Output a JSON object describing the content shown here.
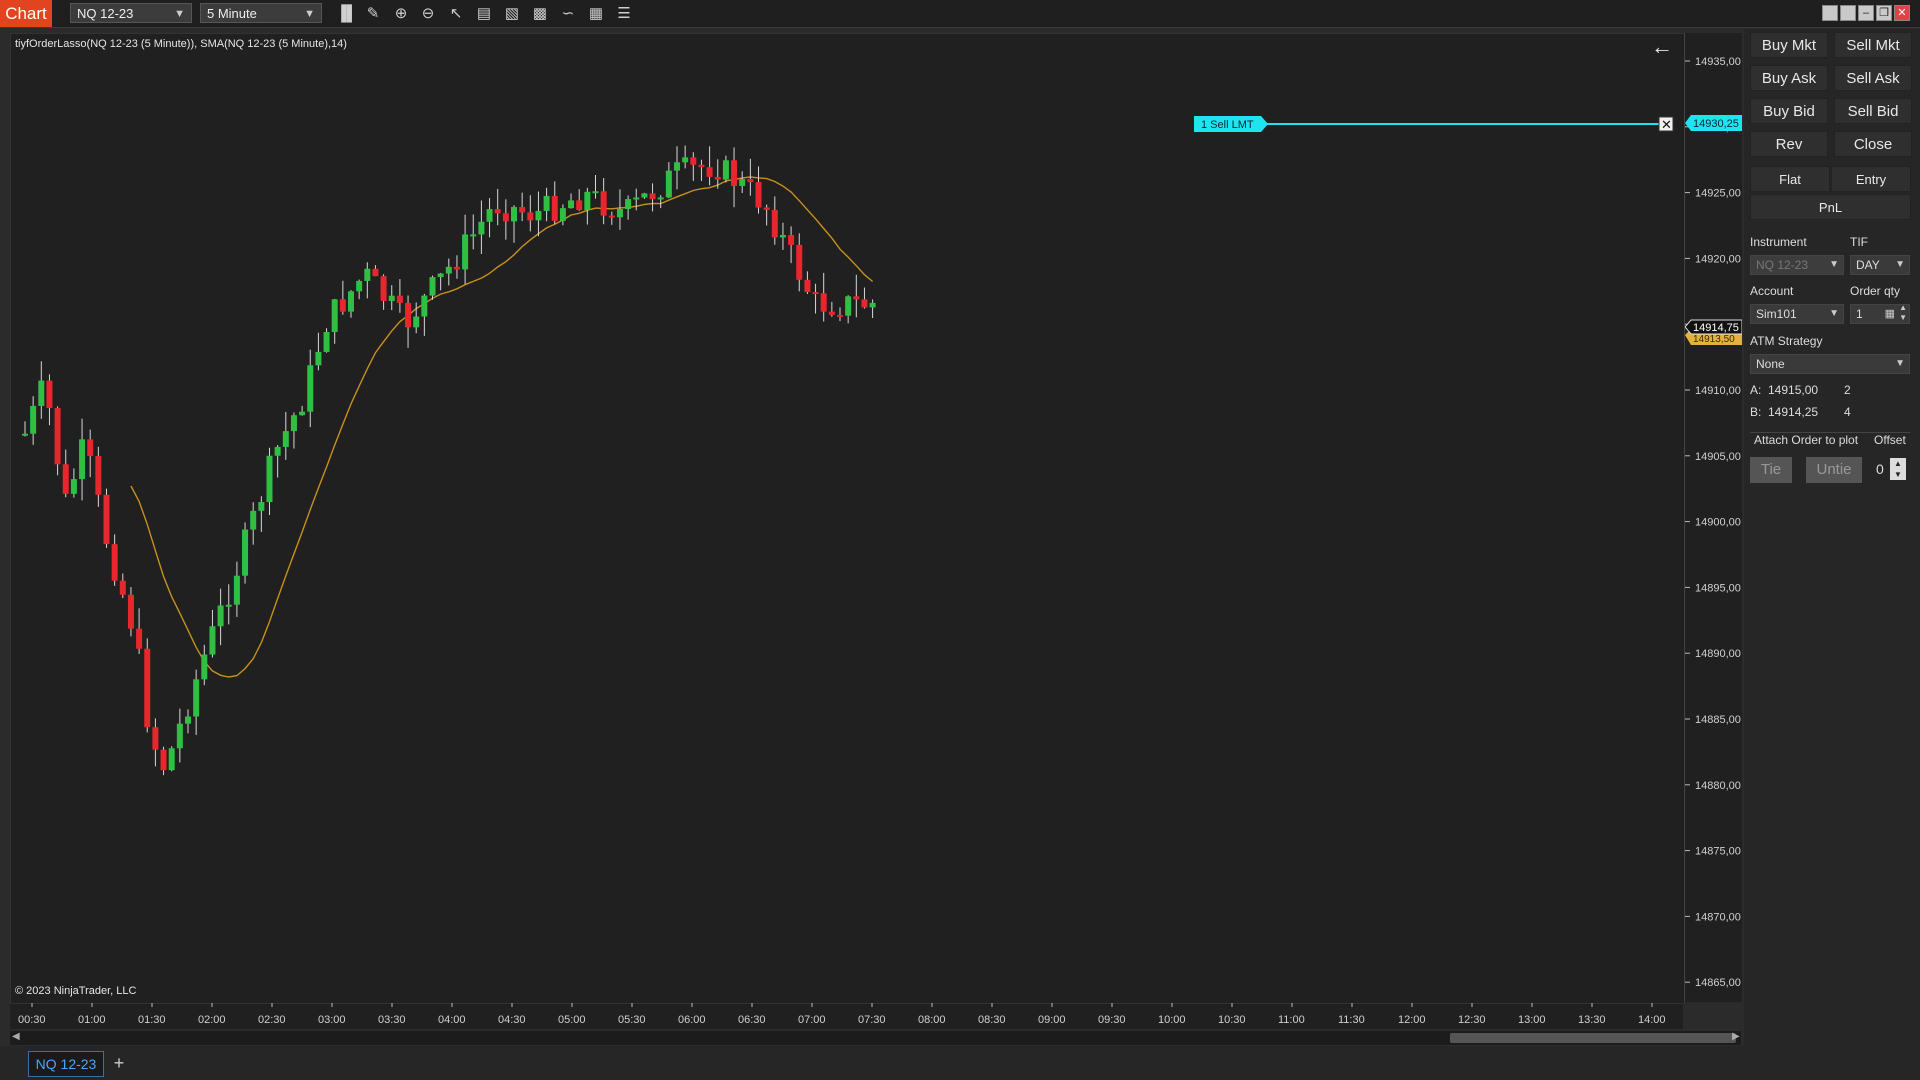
{
  "toolbar": {
    "chart_label": "Chart",
    "instrument": "NQ 12-23",
    "interval": "5 Minute",
    "tools": [
      "bar-chart-icon",
      "pencil-icon",
      "zoom-in-icon",
      "zoom-out-icon",
      "pointer-icon",
      "properties-icon",
      "data-box-icon",
      "strategies-icon",
      "indicators-icon",
      "calculator-icon",
      "list-icon"
    ]
  },
  "chart": {
    "indicator_label": "tiyfOrderLasso(NQ 12-23 (5 Minute)), SMA(NQ 12-23 (5 Minute),14)",
    "copyright": "© 2023 NinjaTrader, LLC",
    "order_label": "1  Sell LMT",
    "order_price": "14930,25",
    "last_price": "14914,75",
    "bid_marker": "14913,50",
    "price_ticks": [
      "14935,00",
      "14930,00",
      "14925,00",
      "14920,00",
      "14915,00",
      "14910,00",
      "14905,00",
      "14900,00",
      "14895,00",
      "14890,00",
      "14885,00",
      "14880,00",
      "14875,00",
      "14870,00",
      "14865,00"
    ],
    "time_ticks": [
      "00:30",
      "01:00",
      "01:30",
      "02:00",
      "02:30",
      "03:00",
      "03:30",
      "04:00",
      "04:30",
      "05:00",
      "05:30",
      "06:00",
      "06:30",
      "07:00",
      "07:30",
      "08:00",
      "08:30",
      "09:00",
      "09:30",
      "10:00",
      "10:30",
      "11:00",
      "11:30",
      "12:00",
      "12:30",
      "13:00",
      "13:30",
      "14:00"
    ],
    "colors": {
      "up": "#2fc043",
      "down": "#e8262d",
      "sma": "#c8901a",
      "order": "#1ee4f0",
      "background": "#202020"
    }
  },
  "tabs": {
    "active": "NQ 12-23",
    "add": "+"
  },
  "panel": {
    "buy_mkt": "Buy Mkt",
    "sell_mkt": "Sell Mkt",
    "buy_ask": "Buy Ask",
    "sell_ask": "Sell Ask",
    "buy_bid": "Buy Bid",
    "sell_bid": "Sell Bid",
    "rev": "Rev",
    "close": "Close",
    "flat": "Flat",
    "entry": "Entry",
    "pnl": "PnL",
    "instrument_label": "Instrument",
    "tif_label": "TIF",
    "instrument_value": "NQ 12-23",
    "tif_value": "DAY",
    "account_label": "Account",
    "qty_label": "Order qty",
    "account_value": "Sim101",
    "qty_value": "1",
    "atm_label": "ATM Strategy",
    "atm_value": "None",
    "ask_label": "A:",
    "ask_price": "14915,00",
    "ask_size": "2",
    "bid_label": "B:",
    "bid_price": "14914,25",
    "bid_size": "4",
    "attach_label": "Attach Order to plot",
    "offset_label": "Offset",
    "tie": "Tie",
    "untie": "Untie",
    "offset_value": "0"
  }
}
